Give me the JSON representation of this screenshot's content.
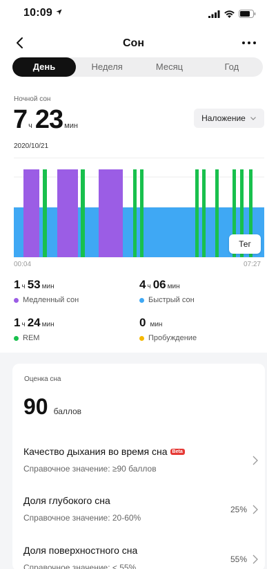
{
  "status": {
    "time": "10:09"
  },
  "nav": {
    "title": "Сон"
  },
  "segments": [
    "День",
    "Неделя",
    "Месяц",
    "Год"
  ],
  "summary": {
    "label": "Ночной сон",
    "hours": "7",
    "hours_unit": "ч",
    "minutes": "23",
    "minutes_unit": "мин",
    "date": "2020/10/21",
    "overlay_label": "Наложение"
  },
  "chart": {
    "start_label": "00:04",
    "end_label": "07:27",
    "tag_label": "Тег",
    "colors": {
      "deep": "#9b5de5",
      "light": "#3fa8f4",
      "rem": "#19c04d"
    }
  },
  "stats": [
    {
      "h": "1",
      "hu": "ч",
      "m": "53",
      "mu": "мин",
      "label": "Медленный сон",
      "color": "#9b5de5"
    },
    {
      "h": "4",
      "hu": "ч",
      "m": "06",
      "mu": "мин",
      "label": "Быстрый сон",
      "color": "#3fa8f4"
    },
    {
      "h": "1",
      "hu": "ч",
      "m": "24",
      "mu": "мин",
      "label": "REM",
      "color": "#19c04d"
    },
    {
      "h": "",
      "hu": "",
      "m": "0",
      "mu": "мин",
      "label": "Пробуждение",
      "color": "#f5b800"
    }
  ],
  "score": {
    "label": "Оценка сна",
    "value": "90",
    "unit": "баллов",
    "metrics": [
      {
        "title": "Качество дыхания во время сна",
        "badge": "Beta",
        "ref": "Справочное значение: ≥90 баллов",
        "value": ""
      },
      {
        "title": "Доля глубокого сна",
        "badge": "",
        "ref": "Справочное значение: 20-60%",
        "value": "25%"
      },
      {
        "title": "Доля поверхностного сна",
        "badge": "",
        "ref": "Справочное значение: < 55%",
        "value": "55%"
      }
    ]
  }
}
